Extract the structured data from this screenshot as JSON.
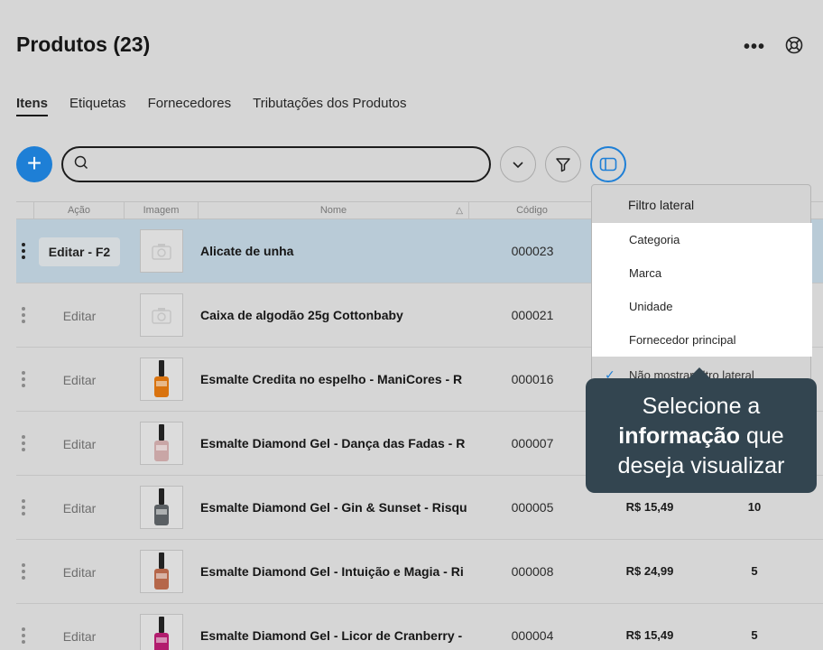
{
  "page": {
    "title": "Produtos (23)"
  },
  "tabs": [
    {
      "label": "Itens",
      "active": true
    },
    {
      "label": "Etiquetas",
      "active": false
    },
    {
      "label": "Fornecedores",
      "active": false
    },
    {
      "label": "Tributações dos Produtos",
      "active": false
    }
  ],
  "search": {
    "placeholder": ""
  },
  "table": {
    "headers": {
      "acao": "Ação",
      "imagem": "Imagem",
      "nome": "Nome",
      "codigo": "Código"
    },
    "edit_selected": "Editar - F2",
    "edit_label": "Editar",
    "rows": [
      {
        "name": "Alicate de unha",
        "code": "000023",
        "price": "",
        "stock": "",
        "image": "placeholder",
        "color": ""
      },
      {
        "name": "Caixa de algodão 25g Cottonbaby",
        "code": "000021",
        "price": "",
        "stock": "",
        "image": "placeholder",
        "color": ""
      },
      {
        "name": "Esmalte Credita no espelho - ManiCores - R",
        "code": "000016",
        "price": "",
        "stock": "",
        "image": "nail-polish",
        "color": "#d9730f"
      },
      {
        "name": "Esmalte Diamond Gel - Dança das Fadas - R",
        "code": "000007",
        "price": "",
        "stock": "",
        "image": "nail-polish",
        "color": "#c9a6a6"
      },
      {
        "name": "Esmalte Diamond Gel - Gin & Sunset - Risqu",
        "code": "000005",
        "price": "R$ 15,49",
        "stock": "10",
        "image": "nail-polish",
        "color": "#5a5f63"
      },
      {
        "name": "Esmalte Diamond Gel - Intuição e Magia - Ri",
        "code": "000008",
        "price": "R$ 24,99",
        "stock": "5",
        "image": "nail-polish",
        "color": "#b5674a"
      },
      {
        "name": "Esmalte Diamond Gel - Licor de Cranberry -",
        "code": "000004",
        "price": "R$ 15,49",
        "stock": "5",
        "image": "nail-polish",
        "color": "#b21c6e"
      }
    ]
  },
  "dropdown": {
    "title": "Filtro lateral",
    "options": [
      {
        "label": "Categoria"
      },
      {
        "label": "Marca"
      },
      {
        "label": "Unidade"
      },
      {
        "label": "Fornecedor principal"
      }
    ],
    "footer": "Não mostrar filtro lateral"
  },
  "tooltip": {
    "line1": "Selecione a",
    "bold": "informação",
    "line2_rest": " que",
    "line3": "deseja visualizar"
  },
  "colors": {
    "accent": "#1e7fd6",
    "tooltip_bg": "#334550",
    "selected_row": "#b9cbd7"
  }
}
